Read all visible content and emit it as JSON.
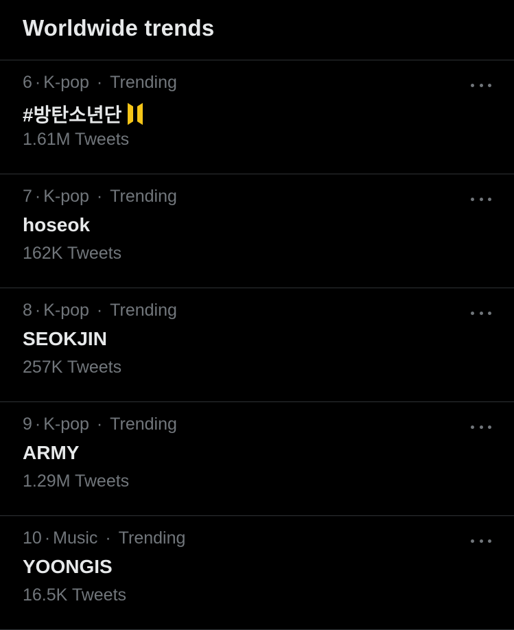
{
  "header": {
    "title": "Worldwide trends"
  },
  "trends": [
    {
      "rank": "6",
      "category": "K-pop",
      "status": "Trending",
      "name": "#방탄소년단",
      "has_emoji": true,
      "emoji_icon": "bts-logo-icon",
      "tweets": "1.61M Tweets"
    },
    {
      "rank": "7",
      "category": "K-pop",
      "status": "Trending",
      "name": "hoseok",
      "tweets": "162K Tweets"
    },
    {
      "rank": "8",
      "category": "K-pop",
      "status": "Trending",
      "name": "SEOKJIN",
      "tweets": "257K Tweets"
    },
    {
      "rank": "9",
      "category": "K-pop",
      "status": "Trending",
      "name": "ARMY",
      "tweets": "1.29M Tweets"
    },
    {
      "rank": "10",
      "category": "Music",
      "status": "Trending",
      "name": "YOONGIS",
      "tweets": "16.5K Tweets"
    }
  ],
  "colors": {
    "background": "#000000",
    "primary_text": "#e7e9ea",
    "secondary_text": "#71767b",
    "divider": "#2f3336",
    "emoji_yellow": "#f5c518"
  },
  "icons": {
    "more": "more-horizontal-icon"
  }
}
